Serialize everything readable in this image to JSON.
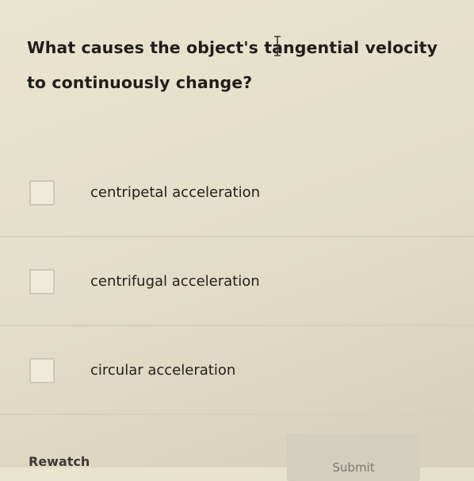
{
  "question": {
    "text": "What causes the object's tangential velocity to continuously change?"
  },
  "options": [
    {
      "label": "centripetal acceleration",
      "checked": false
    },
    {
      "label": "centrifugal acceleration",
      "checked": false
    },
    {
      "label": "circular acceleration",
      "checked": false
    }
  ],
  "actions": {
    "rewatch_label": "Rewatch",
    "submit_label": "Submit"
  },
  "colors": {
    "background": "#e6e1cc",
    "text": "#201e1a",
    "submit_bg": "#d3cfbd",
    "submit_text": "#7c786c"
  }
}
